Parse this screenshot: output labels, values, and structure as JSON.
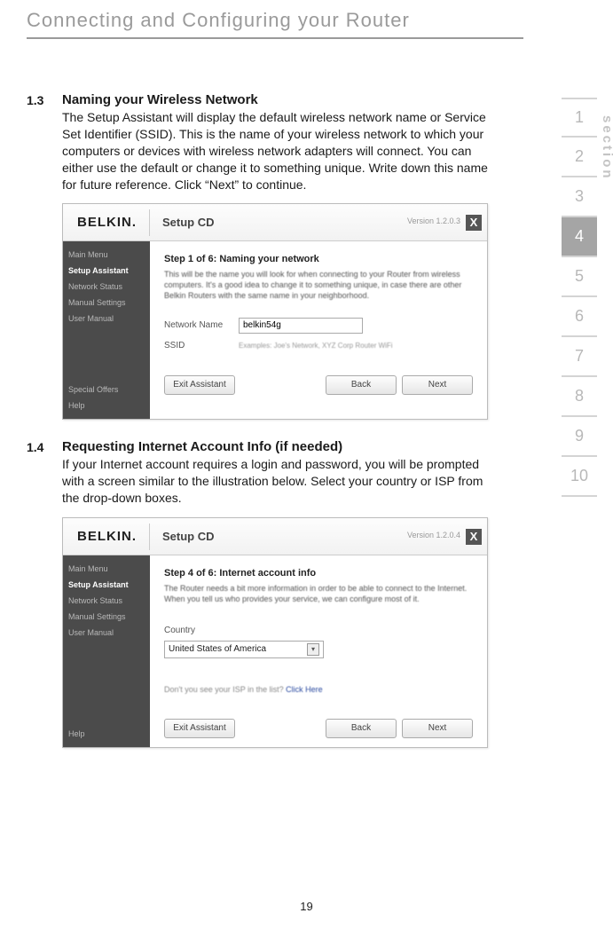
{
  "page": {
    "title": "Connecting and Configuring your Router",
    "number": "19"
  },
  "section_nav": {
    "label": "section",
    "items": [
      "1",
      "2",
      "3",
      "4",
      "5",
      "6",
      "7",
      "8",
      "9",
      "10"
    ],
    "active_index": 3
  },
  "steps": [
    {
      "num": "1.3",
      "title": "Naming your Wireless Network",
      "text": "The Setup Assistant will display the default wireless network name or Service Set Identifier (SSID). This is the name of your wireless network to which your computers or devices with wireless network adapters will connect. You can either use the default or change it to something unique. Write down this name for future reference. Click “Next” to continue."
    },
    {
      "num": "1.4",
      "title": "Requesting Internet Account Info (if needed)",
      "text": "If your Internet account requires a login and password, you will be prompted with a screen similar to the illustration below. Select your country or ISP from the drop-down boxes."
    }
  ],
  "screenshot_common": {
    "logo": "BELKIN.",
    "header_title": "Setup CD",
    "close": "X",
    "nav": {
      "items": [
        "Main Menu",
        "Setup Assistant",
        "Network Status",
        "Manual Settings",
        "User Manual"
      ],
      "bottom": [
        "Special Offers",
        "Help"
      ],
      "active_index": 1
    },
    "buttons": {
      "exit": "Exit Assistant",
      "back": "Back",
      "next": "Next"
    }
  },
  "screenshot1": {
    "version": "Version 1.2.0.3",
    "step_title": "Step 1 of 6: Naming your network",
    "step_text": "This will be the name you will look for when connecting to your Router from wireless computers. It's a good idea to change it to something unique, in case there are other Belkin Routers with the same name in your neighborhood.",
    "field_label": "Network Name",
    "field_value": "belkin54g",
    "hint_label": "SSID",
    "hint_text": "Examples: Joe's Network, XYZ Corp Router WiFi"
  },
  "screenshot2": {
    "version": "Version 1.2.0.4",
    "step_title": "Step 4 of 6: Internet account info",
    "step_text": "The Router needs a bit more information in order to be able to connect to the Internet. When you tell us who provides your service, we can configure most of it.",
    "country_label": "Country",
    "country_value": "United States of America",
    "note_prefix": "Don't you see your ISP in the list? ",
    "note_link": "Click Here"
  }
}
